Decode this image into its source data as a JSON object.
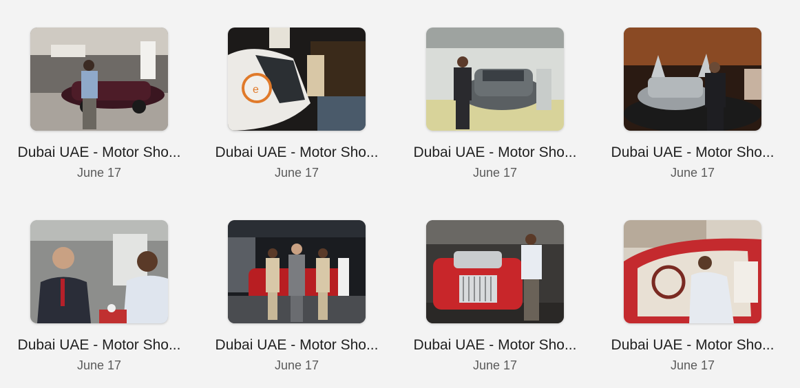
{
  "gallery": {
    "items": [
      {
        "title": "Dubai UAE - Motor Sho...",
        "date": "June 17",
        "image": "vintage-car-man"
      },
      {
        "title": "Dubai UAE - Motor Sho...",
        "date": "June 17",
        "image": "white-car-display"
      },
      {
        "title": "Dubai UAE - Motor Sho...",
        "date": "June 17",
        "image": "gray-sedan-man"
      },
      {
        "title": "Dubai UAE - Motor Sho...",
        "date": "June 17",
        "image": "silver-roadster-man"
      },
      {
        "title": "Dubai UAE - Motor Sho...",
        "date": "June 17",
        "image": "men-talking-table"
      },
      {
        "title": "Dubai UAE - Motor Sho...",
        "date": "June 17",
        "image": "three-people-red-car"
      },
      {
        "title": "Dubai UAE - Motor Sho...",
        "date": "June 17",
        "image": "red-rolls-royce-man"
      },
      {
        "title": "Dubai UAE - Motor Sho...",
        "date": "June 17",
        "image": "man-in-red-car"
      }
    ]
  }
}
